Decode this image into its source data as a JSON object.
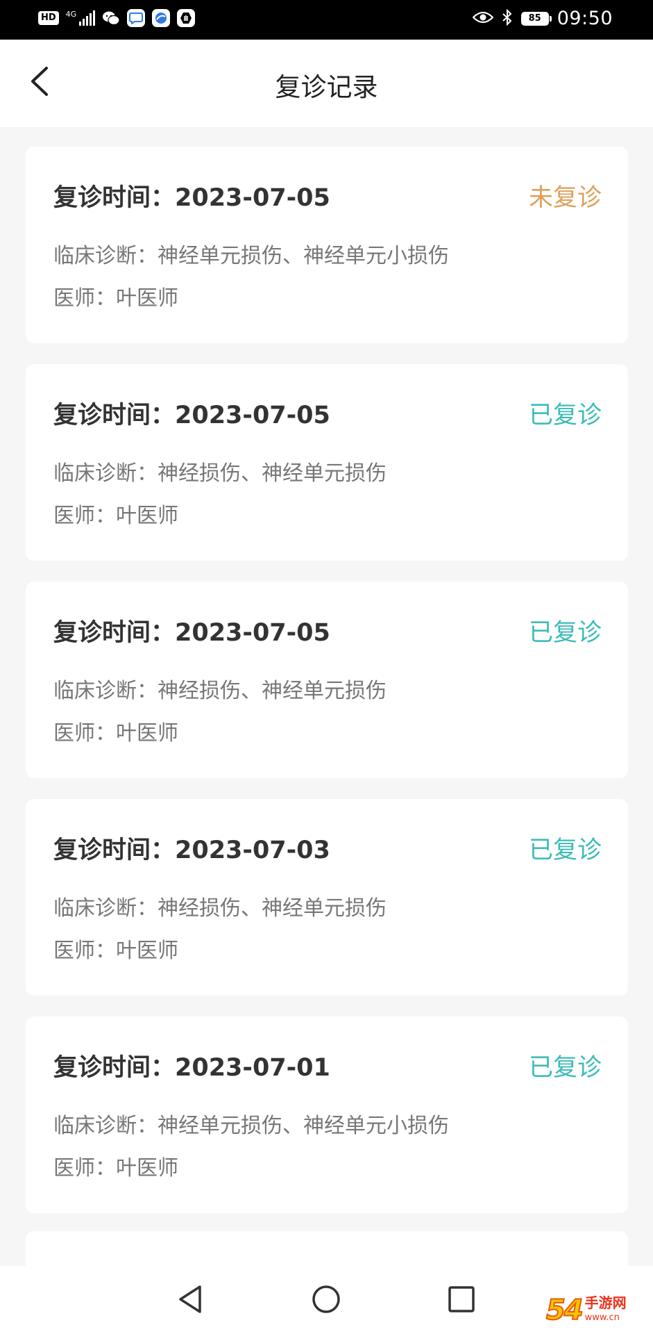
{
  "status_bar": {
    "hd_badge": "HD",
    "network": "4G",
    "battery": "85",
    "time": "09:50"
  },
  "header": {
    "title": "复诊记录"
  },
  "records": [
    {
      "date_label": "复诊时间：2023-07-05",
      "status": "未复诊",
      "diagnosis": "临床诊断：神经单元损伤、神经单元小损伤",
      "doctor": "医师：叶医师"
    },
    {
      "date_label": "复诊时间：2023-07-05",
      "status": "已复诊",
      "diagnosis": "临床诊断：神经损伤、神经单元损伤",
      "doctor": "医师：叶医师"
    },
    {
      "date_label": "复诊时间：2023-07-05",
      "status": "已复诊",
      "diagnosis": "临床诊断：神经损伤、神经单元损伤",
      "doctor": "医师：叶医师"
    },
    {
      "date_label": "复诊时间：2023-07-03",
      "status": "已复诊",
      "diagnosis": "临床诊断：神经损伤、神经单元损伤",
      "doctor": "医师：叶医师"
    },
    {
      "date_label": "复诊时间：2023-07-01",
      "status": "已复诊",
      "diagnosis": "临床诊断：神经单元损伤、神经单元小损伤",
      "doctor": "医师：叶医师"
    }
  ],
  "status_colors": {
    "pending": "#e0a05a",
    "done": "#3dbcb8"
  },
  "watermark": {
    "number": "54",
    "site": "手游网",
    "url": "www.cn"
  },
  "icons": {
    "back": "chevron-left-icon",
    "nav_back": "triangle-back-icon",
    "nav_home": "circle-home-icon",
    "nav_recents": "square-recents-icon"
  }
}
